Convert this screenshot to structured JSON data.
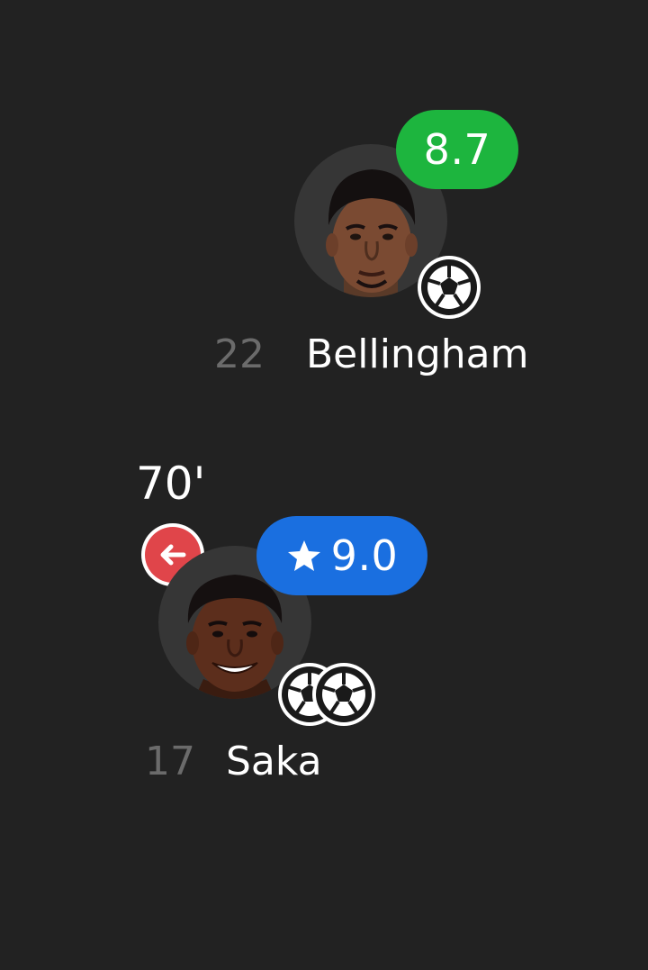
{
  "colors": {
    "background": "#222222",
    "rating_green": "#1db53e",
    "rating_blue": "#1a6fe0",
    "sub_out_red": "#e0454a"
  },
  "players": [
    {
      "number": "22",
      "name": "Bellingham",
      "rating": "8.7",
      "rating_color": "green",
      "goals": 1,
      "icons": [
        "player-photo",
        "soccer-ball-icon"
      ]
    },
    {
      "number": "17",
      "name": "Saka",
      "rating": "9.0",
      "rating_color": "blue",
      "player_of_match": true,
      "goals": 2,
      "sub_time": "70'",
      "icons": [
        "player-photo",
        "star-icon",
        "soccer-ball-icon",
        "arrow-left-icon"
      ]
    }
  ]
}
